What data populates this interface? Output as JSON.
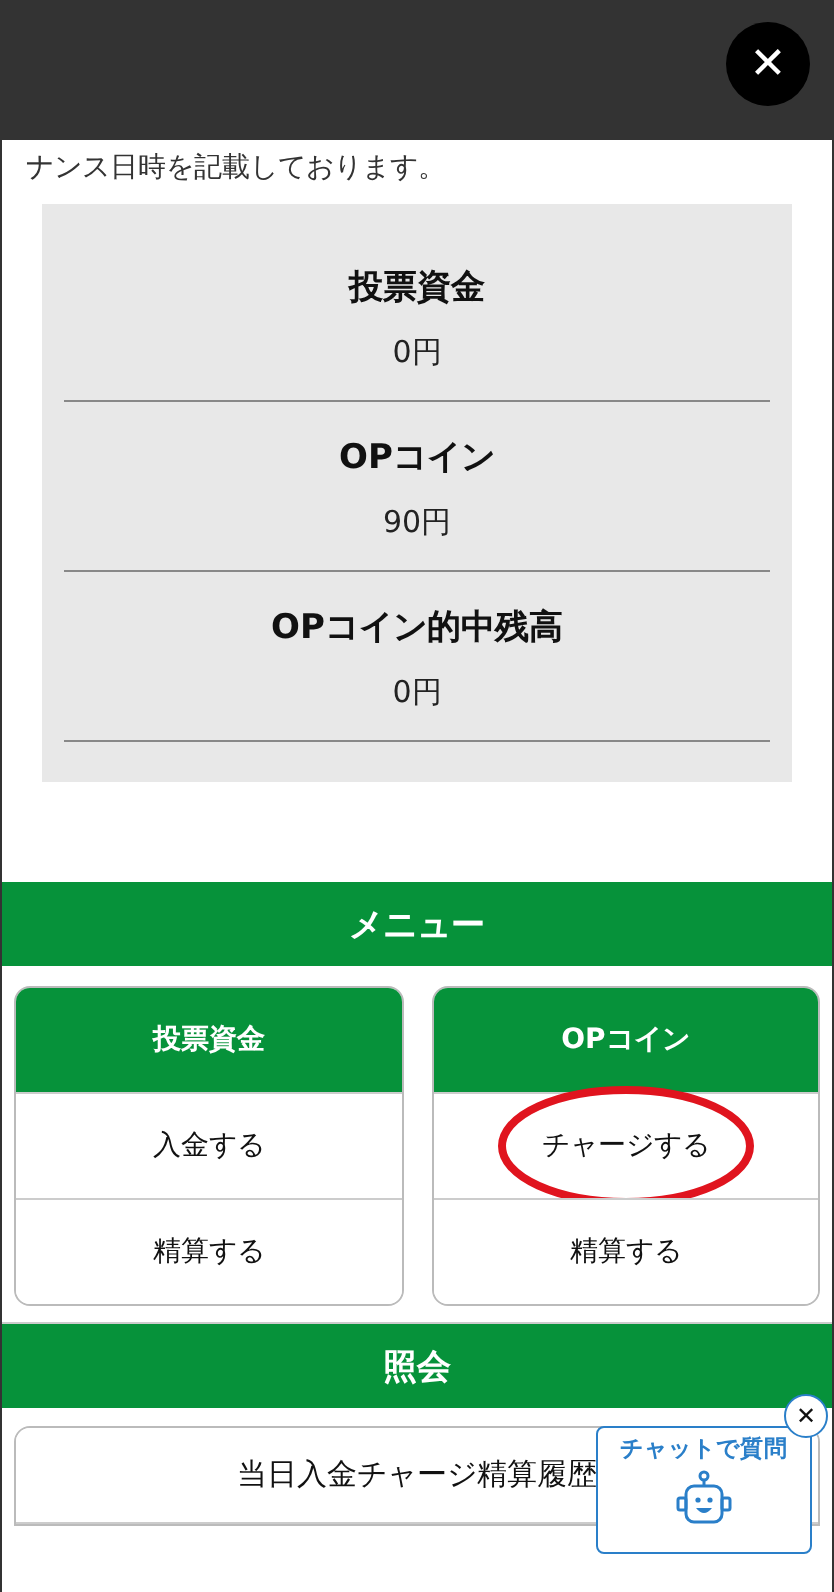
{
  "close_button": {
    "label": "✕"
  },
  "intro_text": "ナンス日時を記載しております。",
  "balances": [
    {
      "label": "投票資金",
      "value": "0円"
    },
    {
      "label": "OPコイン",
      "value": "90円"
    },
    {
      "label": "OPコイン的中残高",
      "value": "0円"
    }
  ],
  "menu": {
    "title": "メニュー",
    "cards": [
      {
        "title": "投票資金",
        "items": [
          {
            "label": "入金する",
            "highlighted": false
          },
          {
            "label": "精算する",
            "highlighted": false
          }
        ]
      },
      {
        "title": "OPコイン",
        "items": [
          {
            "label": "チャージする",
            "highlighted": true
          },
          {
            "label": "精算する",
            "highlighted": false
          }
        ]
      }
    ]
  },
  "inquiry": {
    "title": "照会",
    "items": [
      {
        "label": "当日入金チャージ精算履歴"
      }
    ]
  },
  "chat_widget": {
    "label": "チャットで質問",
    "close": "✕"
  }
}
